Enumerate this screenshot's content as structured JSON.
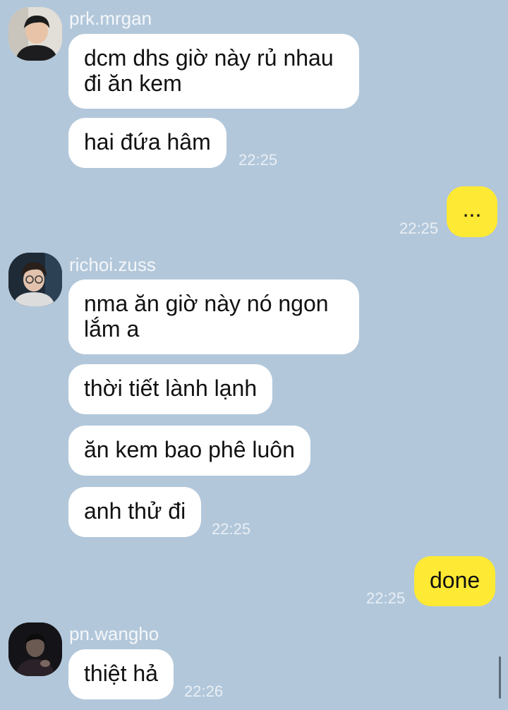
{
  "chat": {
    "groups": [
      {
        "sender": "prk.mrgan",
        "messages": [
          "dcm dhs giờ này rủ nhau đi ăn kem",
          "hai đứa hâm"
        ],
        "time": "22:25"
      },
      {
        "me": true,
        "messages": [
          "..."
        ],
        "time": "22:25"
      },
      {
        "sender": "richoi.zuss",
        "messages": [
          "nma ăn giờ này nó ngon lắm a",
          "thời tiết lành lạnh",
          "ăn kem bao phê luôn",
          "anh thử đi"
        ],
        "time": "22:25"
      },
      {
        "me": true,
        "messages": [
          "done"
        ],
        "time": "22:25"
      },
      {
        "sender": "pn.wangho",
        "messages": [
          "thiệt hả"
        ],
        "time": "22:26"
      }
    ]
  },
  "colors": {
    "background": "#b2c7da",
    "incoming_bubble": "#ffffff",
    "outgoing_bubble": "#fee934",
    "meta_text": "#e9eff5"
  }
}
